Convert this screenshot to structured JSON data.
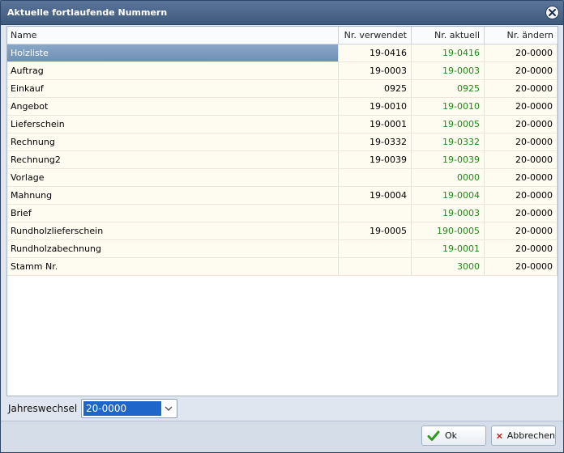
{
  "window": {
    "title": "Aktuelle fortlaufende Nummern"
  },
  "columns": {
    "name": "Name",
    "used": "Nr. verwendet",
    "current": "Nr. aktuell",
    "change": "Nr. ändern"
  },
  "rows": [
    {
      "name": "Holzliste",
      "used": "19-0416",
      "current": "19-0416",
      "change": "20-0000",
      "selected": true
    },
    {
      "name": "Auftrag",
      "used": "19-0003",
      "current": "19-0003",
      "change": "20-0000"
    },
    {
      "name": "Einkauf",
      "used": "0925",
      "current": "0925",
      "change": "20-0000"
    },
    {
      "name": "Angebot",
      "used": "19-0010",
      "current": "19-0010",
      "change": "20-0000"
    },
    {
      "name": "Lieferschein",
      "used": "19-0001",
      "current": "19-0005",
      "change": "20-0000"
    },
    {
      "name": "Rechnung",
      "used": "19-0332",
      "current": "19-0332",
      "change": "20-0000"
    },
    {
      "name": "Rechnung2",
      "used": "19-0039",
      "current": "19-0039",
      "change": "20-0000"
    },
    {
      "name": "Vorlage",
      "used": "",
      "current": "0000",
      "change": "20-0000"
    },
    {
      "name": "Mahnung",
      "used": "19-0004",
      "current": "19-0004",
      "change": "20-0000"
    },
    {
      "name": "Brief",
      "used": "",
      "current": "19-0003",
      "change": "20-0000"
    },
    {
      "name": "Rundholzlieferschein",
      "used": "19-0005",
      "current": "190-0005",
      "change": "20-0000"
    },
    {
      "name": "Rundholzabechnung",
      "used": "",
      "current": "19-0001",
      "change": "20-0000"
    },
    {
      "name": "Stamm Nr.",
      "used": "",
      "current": "3000",
      "change": "20-0000"
    }
  ],
  "jahreswechsel": {
    "label": "Jahreswechsel",
    "value": "20-0000"
  },
  "buttons": {
    "ok": "Ok",
    "cancel": "Abbrechen"
  },
  "icons": {
    "close": "close-icon",
    "ok": "check-icon",
    "cancel": "x-icon",
    "dropdown": "chevron-down-icon"
  },
  "colors": {
    "title_bar": "#4a6688",
    "selected_row": "#7b9abd",
    "current_number": "#1f8a16",
    "row_bg": "#fefbf0"
  }
}
